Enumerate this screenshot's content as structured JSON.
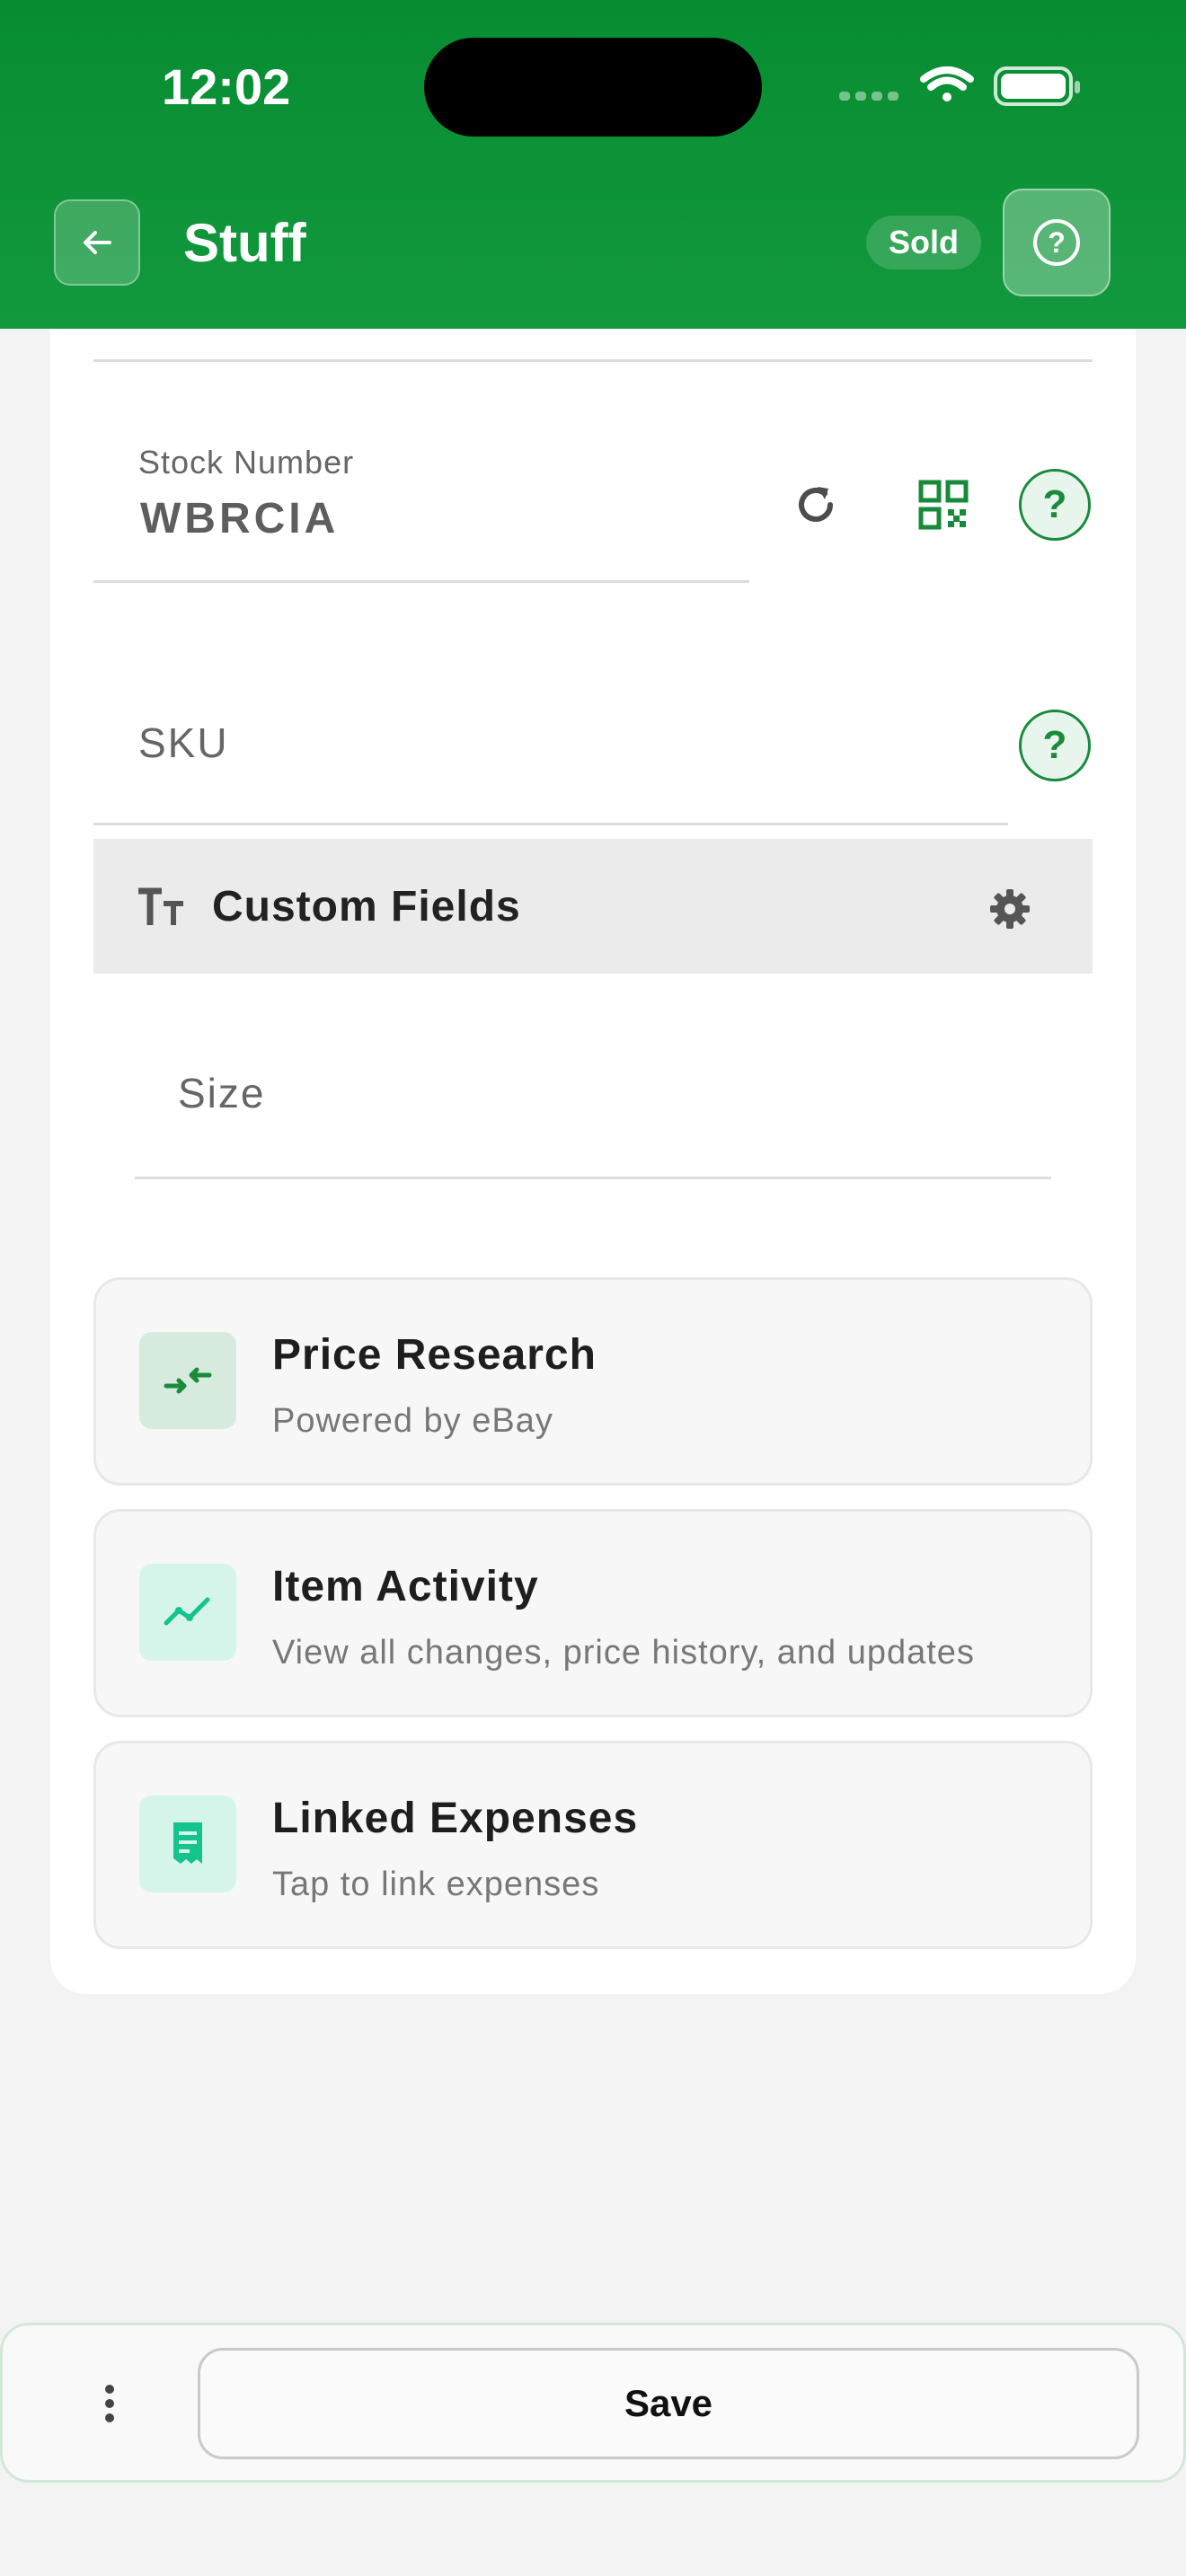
{
  "status_bar": {
    "time": "12:02"
  },
  "header": {
    "title": "Stuff",
    "badge": "Sold",
    "help_glyph": "?",
    "back_icon": "arrow-left-icon",
    "help_icon": "question-circle-icon"
  },
  "fields": {
    "stock_number": {
      "label": "Stock Number",
      "value": "WBRCIA",
      "refresh_icon": "refresh-icon",
      "qr_icon": "qr-code-icon",
      "help_glyph": "?"
    },
    "sku": {
      "placeholder": "SKU",
      "help_glyph": "?"
    }
  },
  "custom_fields": {
    "title": "Custom Fields",
    "title_icon": "text-size-icon",
    "settings_icon": "gear-icon",
    "size_placeholder": "Size"
  },
  "cards": [
    {
      "title": "Price Research",
      "subtitle": "Powered by eBay",
      "icon": "compare-arrows-icon"
    },
    {
      "title": "Item Activity",
      "subtitle": "View all changes, price history, and updates",
      "icon": "trend-line-icon"
    },
    {
      "title": "Linked Expenses",
      "subtitle": "Tap to link expenses",
      "icon": "receipt-icon"
    }
  ],
  "footer": {
    "save_label": "Save",
    "more_icon": "more-vertical-icon"
  },
  "colors": {
    "brand_green": "#078c32",
    "accent_green": "#1a8a3c",
    "teal": "#14c38e",
    "background": "#f3f3f3"
  }
}
